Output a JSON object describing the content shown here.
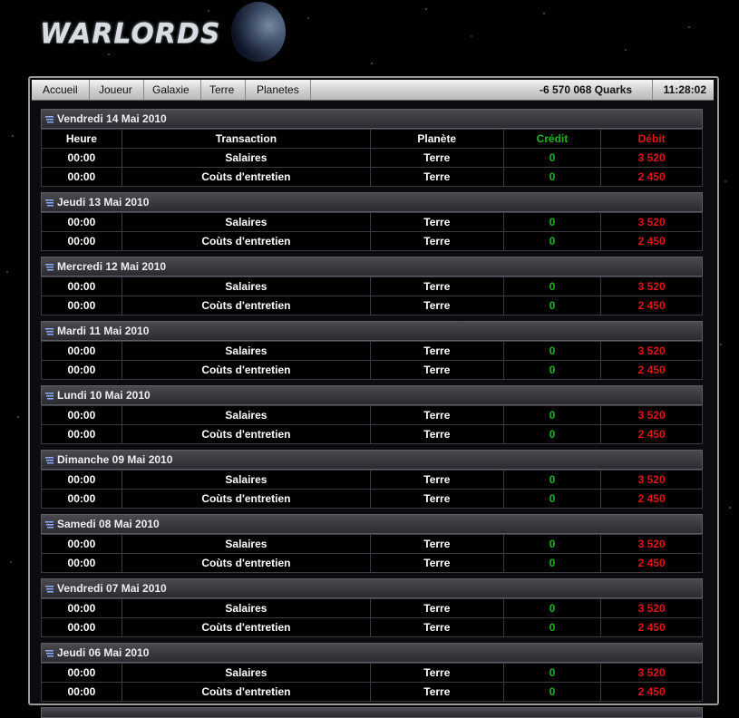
{
  "logo": {
    "text": "WARLORDS"
  },
  "nav": {
    "items": [
      "Accueil",
      "Joueur",
      "Galaxie",
      "Terre",
      "Planetes"
    ],
    "balance": "-6 570 068 Quarks",
    "time": "11:28:02"
  },
  "columns": {
    "heure": "Heure",
    "transaction": "Transaction",
    "planete": "Planète",
    "credit": "Crédit",
    "debit": "Débit"
  },
  "colors": {
    "credit": "#18b818",
    "debit": "#e01515"
  },
  "days": [
    {
      "date": "Vendredi 14 Mai 2010",
      "show_header": true,
      "rows": [
        {
          "heure": "00:00",
          "transaction": "Salaires",
          "planete": "Terre",
          "credit": "0",
          "debit": "3 520"
        },
        {
          "heure": "00:00",
          "transaction": "Coùts d'entretien",
          "planete": "Terre",
          "credit": "0",
          "debit": "2 450"
        }
      ]
    },
    {
      "date": "Jeudi 13 Mai 2010",
      "rows": [
        {
          "heure": "00:00",
          "transaction": "Salaires",
          "planete": "Terre",
          "credit": "0",
          "debit": "3 520"
        },
        {
          "heure": "00:00",
          "transaction": "Coùts d'entretien",
          "planete": "Terre",
          "credit": "0",
          "debit": "2 450"
        }
      ]
    },
    {
      "date": "Mercredi 12 Mai 2010",
      "rows": [
        {
          "heure": "00:00",
          "transaction": "Salaires",
          "planete": "Terre",
          "credit": "0",
          "debit": "3 520"
        },
        {
          "heure": "00:00",
          "transaction": "Coùts d'entretien",
          "planete": "Terre",
          "credit": "0",
          "debit": "2 450"
        }
      ]
    },
    {
      "date": "Mardi 11 Mai 2010",
      "rows": [
        {
          "heure": "00:00",
          "transaction": "Salaires",
          "planete": "Terre",
          "credit": "0",
          "debit": "3 520"
        },
        {
          "heure": "00:00",
          "transaction": "Coùts d'entretien",
          "planete": "Terre",
          "credit": "0",
          "debit": "2 450"
        }
      ]
    },
    {
      "date": "Lundi 10 Mai 2010",
      "rows": [
        {
          "heure": "00:00",
          "transaction": "Salaires",
          "planete": "Terre",
          "credit": "0",
          "debit": "3 520"
        },
        {
          "heure": "00:00",
          "transaction": "Coùts d'entretien",
          "planete": "Terre",
          "credit": "0",
          "debit": "2 450"
        }
      ]
    },
    {
      "date": "Dimanche 09 Mai 2010",
      "rows": [
        {
          "heure": "00:00",
          "transaction": "Salaires",
          "planete": "Terre",
          "credit": "0",
          "debit": "3 520"
        },
        {
          "heure": "00:00",
          "transaction": "Coùts d'entretien",
          "planete": "Terre",
          "credit": "0",
          "debit": "2 450"
        }
      ]
    },
    {
      "date": "Samedi 08 Mai 2010",
      "rows": [
        {
          "heure": "00:00",
          "transaction": "Salaires",
          "planete": "Terre",
          "credit": "0",
          "debit": "3 520"
        },
        {
          "heure": "00:00",
          "transaction": "Coùts d'entretien",
          "planete": "Terre",
          "credit": "0",
          "debit": "2 450"
        }
      ]
    },
    {
      "date": "Vendredi 07 Mai 2010",
      "rows": [
        {
          "heure": "00:00",
          "transaction": "Salaires",
          "planete": "Terre",
          "credit": "0",
          "debit": "3 520"
        },
        {
          "heure": "00:00",
          "transaction": "Coùts d'entretien",
          "planete": "Terre",
          "credit": "0",
          "debit": "2 450"
        }
      ]
    },
    {
      "date": "Jeudi 06 Mai 2010",
      "rows": [
        {
          "heure": "00:00",
          "transaction": "Salaires",
          "planete": "Terre",
          "credit": "0",
          "debit": "3 520"
        },
        {
          "heure": "00:00",
          "transaction": "Coùts d'entretien",
          "planete": "Terre",
          "credit": "0",
          "debit": "2 450"
        }
      ]
    }
  ]
}
